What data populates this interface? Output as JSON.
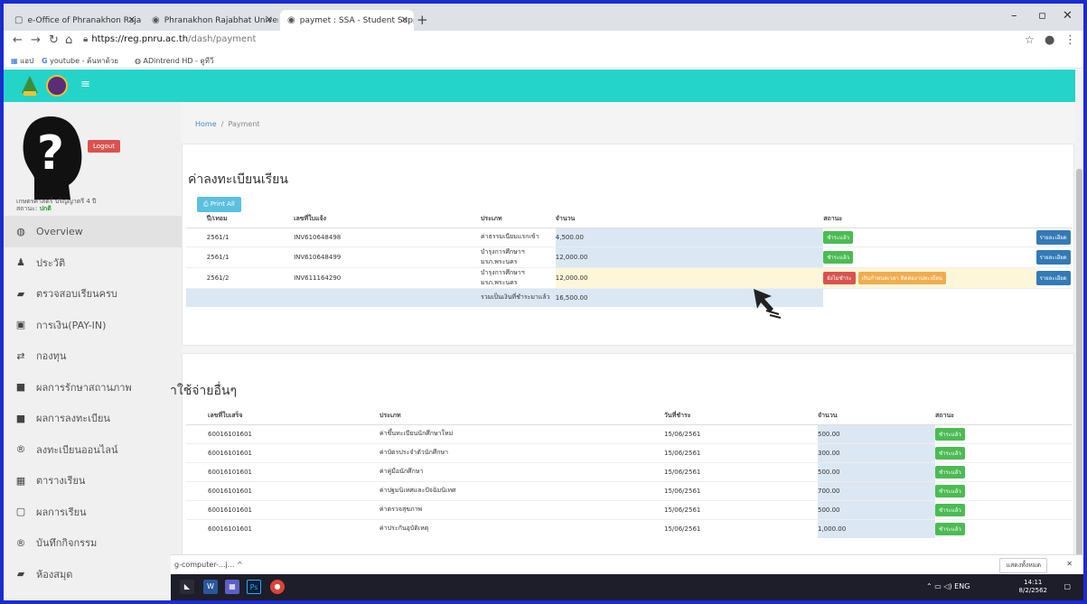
{
  "browser": {
    "tabs": [
      {
        "label": "e-Office of Phranakhon Rajabhat",
        "active": false
      },
      {
        "label": "Phranakhon Rajabhat University",
        "active": false
      },
      {
        "label": "paymet : SSA - Student Support",
        "active": true
      }
    ],
    "url_host": "https://reg.pnru.ac.th",
    "url_path": "/dash/payment",
    "bookmarks": [
      "แอป",
      "youtube - ค้นหาด้วย",
      "ADintrend HD - ดูทีวี"
    ]
  },
  "sidebar": {
    "logout_label": "Logout",
    "student_line1": "เกษตรศาสตร์ ปริญญาตรี 4 ปี",
    "status_prefix": "สถานะ:",
    "status_value": "ปกติ",
    "items": [
      {
        "label": "Overview",
        "icon": "dashboard-icon",
        "glyph": "◍"
      },
      {
        "label": "ประวัติ",
        "icon": "user-icon",
        "glyph": "♟"
      },
      {
        "label": "ตรวจสอบเรียนครบ",
        "icon": "book-icon",
        "glyph": "▰"
      },
      {
        "label": "การเงิน(PAY-IN)",
        "icon": "money-icon",
        "glyph": "▣"
      },
      {
        "label": "กองทุน",
        "icon": "exchange-icon",
        "glyph": "⇄"
      },
      {
        "label": "ผลการรักษาสถานภาพ",
        "icon": "file-icon",
        "glyph": "■"
      },
      {
        "label": "ผลการลงทะเบียน",
        "icon": "list-icon",
        "glyph": "■"
      },
      {
        "label": "ลงทะเบียนออนไลน์",
        "icon": "registered-icon",
        "glyph": "®"
      },
      {
        "label": "ตารางเรียน",
        "icon": "calendar-icon",
        "glyph": "▦"
      },
      {
        "label": "ผลการเรียน",
        "icon": "bookmark-icon",
        "glyph": "▢"
      },
      {
        "label": "บันทึกกิจกรรม",
        "icon": "registered-icon",
        "glyph": "®"
      },
      {
        "label": "ห้องสมุด",
        "icon": "book-icon",
        "glyph": "▰"
      }
    ]
  },
  "breadcrumb": {
    "home": "Home",
    "sep": "/",
    "current": "Payment"
  },
  "fees": {
    "title": "ค่าลงทะเบียนเรียน",
    "print_label": "Print All",
    "headers": [
      "ปี/เทอม",
      "เลขที่ใบแจ้ง",
      "ประเภท",
      "จำนวน",
      "สถานะ"
    ],
    "rows": [
      {
        "term": "2561/1",
        "invoice": "INV610648498",
        "type": "ค่าธรรมเนียมแรกเข้า",
        "amount": "4,500.00",
        "status": "ชำระแล้ว",
        "detail": "รายละเอียด"
      },
      {
        "term": "2561/1",
        "invoice": "INV610648499",
        "type": "บำรุงการศึกษาฯ มรภ.พระนคร",
        "amount": "12,000.00",
        "status": "ชำระแล้ว",
        "detail": "รายละเอียด"
      },
      {
        "term": "2561/2",
        "invoice": "INV611164290",
        "type": "บำรุงการศึกษาฯ มรภ.พระนคร",
        "amount": "12,000.00",
        "status": "ยังไม่ชำระ",
        "extra": "เกินกำหนดเวลา ติดต่องานทะเบียน",
        "detail": "รายละเอียด"
      }
    ],
    "total_label": "รวมเป็นเงินที่ชำระมาแล้ว",
    "total_value": "16,500.00"
  },
  "other": {
    "title": "าใช้จ่ายอื่นๆ",
    "headers": [
      "เลขที่ใบเสร็จ",
      "ประเภท",
      "วันที่ชำระ",
      "จำนวน",
      "สถานะ"
    ],
    "rows": [
      {
        "receipt": "60016101601",
        "type": "ค่าขึ้นทะเบียนนักศึกษาใหม่",
        "date": "15/06/2561",
        "amount": "500.00",
        "status": "ชำระแล้ว"
      },
      {
        "receipt": "60016101601",
        "type": "ค่าบัตรประจำตัวนักศึกษา",
        "date": "15/06/2561",
        "amount": "300.00",
        "status": "ชำระแล้ว"
      },
      {
        "receipt": "60016101601",
        "type": "ค่าคู่มือนักศึกษา",
        "date": "15/06/2561",
        "amount": "500.00",
        "status": "ชำระแล้ว"
      },
      {
        "receipt": "60016101601",
        "type": "ค่าปฐมนิเทศและปัจฉิมนิเทศ",
        "date": "15/06/2561",
        "amount": "700.00",
        "status": "ชำระแล้ว"
      },
      {
        "receipt": "60016101601",
        "type": "ค่าตรวจสุขภาพ",
        "date": "15/06/2561",
        "amount": "500.00",
        "status": "ชำระแล้ว"
      },
      {
        "receipt": "60016101601",
        "type": "ค่าประกันอุบัติเหตุ",
        "date": "15/06/2561",
        "amount": "1,000.00",
        "status": "ชำระแล้ว"
      }
    ]
  },
  "download_bar": {
    "file": "g-computer-...j...",
    "show_all": "แสดงทั้งหมด"
  },
  "taskbar": {
    "lang": "ENG",
    "time": "14:11",
    "date": "8/2/2562"
  }
}
